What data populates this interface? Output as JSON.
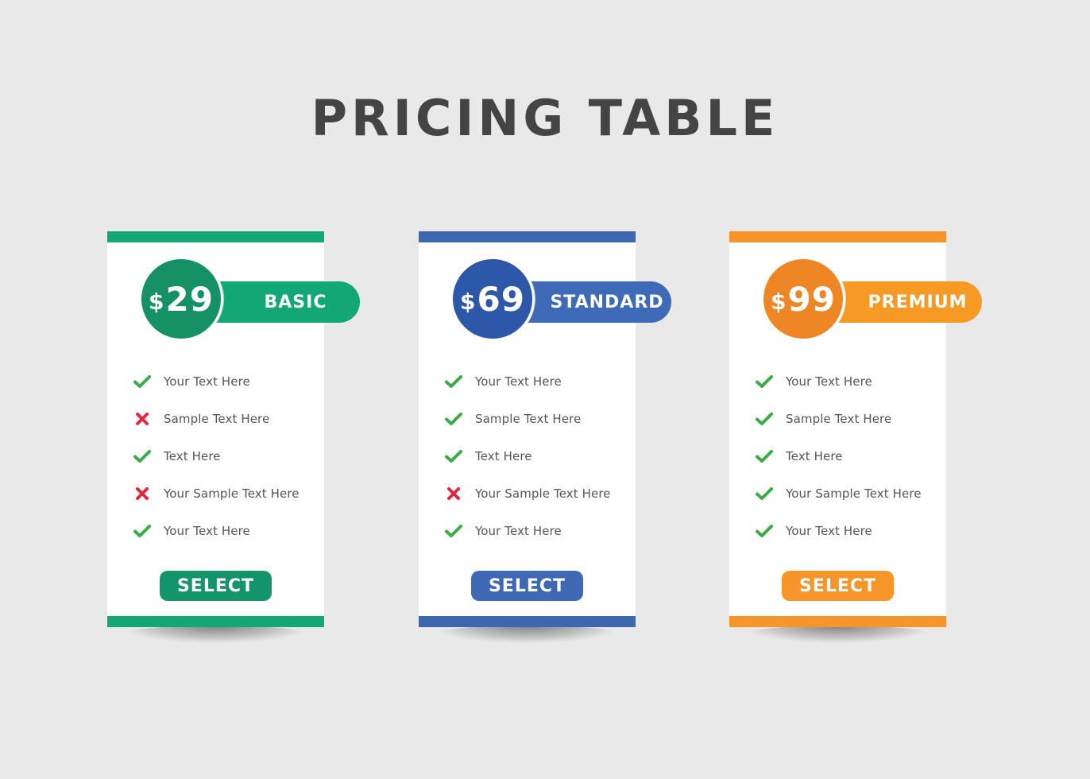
{
  "page": {
    "title": "PRICING TABLE"
  },
  "plans": [
    {
      "name": "BASIC",
      "currency": "$",
      "price": "29",
      "colors": {
        "primary": "#13a776",
        "dark": "#169166",
        "bar": "#13a776",
        "button": "#14946a"
      },
      "features": [
        {
          "label": "Your Text Here",
          "included": true,
          "icon": "check-icon"
        },
        {
          "label": "Sample Text Here",
          "included": false,
          "icon": "cross-icon"
        },
        {
          "label": "Text Here",
          "included": true,
          "icon": "check-icon"
        },
        {
          "label": "Your Sample Text Here",
          "included": false,
          "icon": "cross-icon"
        },
        {
          "label": "Your Text Here",
          "included": true,
          "icon": "check-icon"
        }
      ],
      "button_label": "SELECT"
    },
    {
      "name": "STANDARD",
      "currency": "$",
      "price": "69",
      "colors": {
        "primary": "#3f6ab7",
        "dark": "#2d57a8",
        "bar": "#3f66b0",
        "button": "#3f69b5"
      },
      "features": [
        {
          "label": "Your Text Here",
          "included": true,
          "icon": "check-icon"
        },
        {
          "label": "Sample Text Here",
          "included": true,
          "icon": "check-icon"
        },
        {
          "label": "Text Here",
          "included": true,
          "icon": "check-icon"
        },
        {
          "label": "Your Sample Text Here",
          "included": false,
          "icon": "cross-icon"
        },
        {
          "label": "Your Text Here",
          "included": true,
          "icon": "check-icon"
        }
      ],
      "button_label": "SELECT"
    },
    {
      "name": "PREMIUM",
      "currency": "$",
      "price": "99",
      "colors": {
        "primary": "#f69a25",
        "dark": "#ee8626",
        "bar": "#f6962a",
        "button": "#f6962a"
      },
      "features": [
        {
          "label": "Your Text Here",
          "included": true,
          "icon": "check-icon"
        },
        {
          "label": "Sample Text Here",
          "included": true,
          "icon": "check-icon"
        },
        {
          "label": "Text Here",
          "included": true,
          "icon": "check-icon"
        },
        {
          "label": "Your Sample Text Here",
          "included": true,
          "icon": "check-icon"
        },
        {
          "label": "Your Text Here",
          "included": true,
          "icon": "check-icon"
        }
      ],
      "button_label": "SELECT"
    }
  ],
  "status_colors": {
    "check": "#3aaa4a",
    "cross": "#e0283f"
  }
}
